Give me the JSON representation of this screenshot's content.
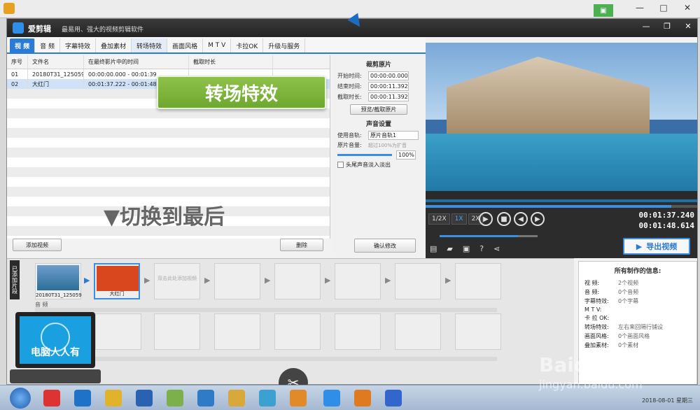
{
  "app": {
    "name": "爱剪辑",
    "slogan": "最易用、强大的视频剪辑软件",
    "min_icon": "—",
    "restore_icon": "❐",
    "close_icon": "✕"
  },
  "tabs": [
    "视 频",
    "音 频",
    "字幕特效",
    "叠加素材",
    "转场特效",
    "画面风格",
    "M T V",
    "卡拉OK",
    "升级与服务"
  ],
  "table": {
    "headers": [
      "序号",
      "文件名",
      "在最终影片中的时间",
      "截取时长"
    ],
    "rows": [
      {
        "idx": "01",
        "name": "20180T31_125059",
        "time": "00:00:00.000 - 00:01:39"
      },
      {
        "idx": "02",
        "name": "大红门",
        "time": "00:01:37.222 - 00:01:48"
      }
    ]
  },
  "hint": "▼切换到最后",
  "banner": "转场特效",
  "crop": {
    "title": "裁剪原片",
    "start_label": "开始时间:",
    "start": "00:00:00.000",
    "end_label": "结束时间:",
    "end": "00:00:11.392",
    "dur_label": "截取时长:",
    "dur": "00:00:11.392",
    "preview_btn": "预览/截取原片",
    "sound_title": "声音设置",
    "track_label": "使用音轨:",
    "track": "原片音轨1",
    "vol_label": "原片音量:",
    "vol_hint": "超过100%为扩音",
    "vol": "100%",
    "fade": "头尾声音淡入淡出",
    "confirm": "确认修改"
  },
  "buttons": {
    "add_video": "添加视频",
    "delete": "删除",
    "export": "导出视频"
  },
  "player": {
    "speeds": [
      "1/2X",
      "1X",
      "2X"
    ],
    "time_current": "00:01:37.240",
    "time_total": "00:01:48.614",
    "progress": 0.9,
    "volume": 0.8
  },
  "track": {
    "side_label": "已添加片段",
    "clips": [
      "20180T31_125059",
      "大红门"
    ],
    "placeholder": "双击此处添加视频",
    "audio_label": "音 频"
  },
  "info": {
    "title": "所有制作的信息:",
    "rows": [
      {
        "k": "视 频:",
        "v": "2个视频"
      },
      {
        "k": "音 频:",
        "v": "0个音频"
      },
      {
        "k": "字幕特效:",
        "v": "0个字幕"
      },
      {
        "k": "M T V:",
        "v": ""
      },
      {
        "k": "卡 拉 OK:",
        "v": ""
      },
      {
        "k": "转场特效:",
        "v": "左右来回隔行铺设"
      },
      {
        "k": "画面风格:",
        "v": "0个画面风格"
      },
      {
        "k": "叠加素材:",
        "v": "0个素材"
      }
    ]
  },
  "laptop_text": "电脑人人有",
  "taskbar_clock": "2018-08-01 星期三",
  "watermark": "Baidu 经验",
  "watermark_sub": "jingyan.baidu.com"
}
